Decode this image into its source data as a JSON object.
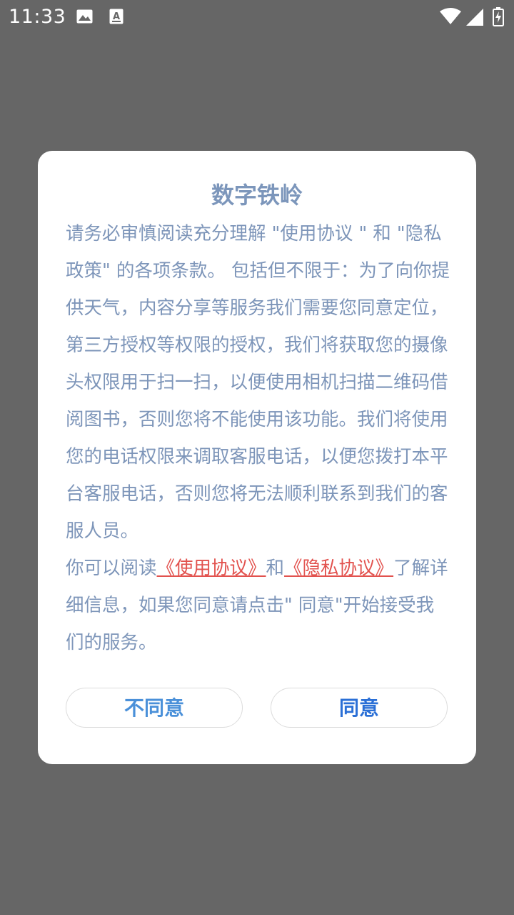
{
  "status_bar": {
    "time": "11:33",
    "icons": [
      "image-icon",
      "text-a-icon",
      "wifi-icon",
      "signal-icon",
      "battery-charging-icon"
    ]
  },
  "dialog": {
    "title": "数字铁岭",
    "paragraph1": "请务必审慎阅读充分理解 \"使用协议 \" 和 \"隐私政策\" 的各项条款。 包括但不限于：为了向你提供天气，内容分享等服务我们需要您同意定位，第三方授权等权限的授权，我们将获取您的摄像头权限用于扫一扫，以便使用相机扫描二维码借阅图书，否则您将不能使用该功能。我们将使用您的电话权限来调取客服电话，以便您拨打本平台客服电话，否则您将无法顺利联系到我们的客服人员。",
    "paragraph2_prefix": "你可以阅读",
    "link_usage": "《使用协议》",
    "paragraph2_and": "和",
    "link_privacy": "《隐私协议》",
    "paragraph2_suffix": "了解详细信息，如果您同意请点击\" 同意\"开始接受我们的服务。",
    "disagree_label": "不同意",
    "agree_label": "同意"
  },
  "colors": {
    "overlay": "#666666",
    "text": "#7d95b9",
    "link": "#e2524e",
    "button_text": "#4a90d9"
  }
}
